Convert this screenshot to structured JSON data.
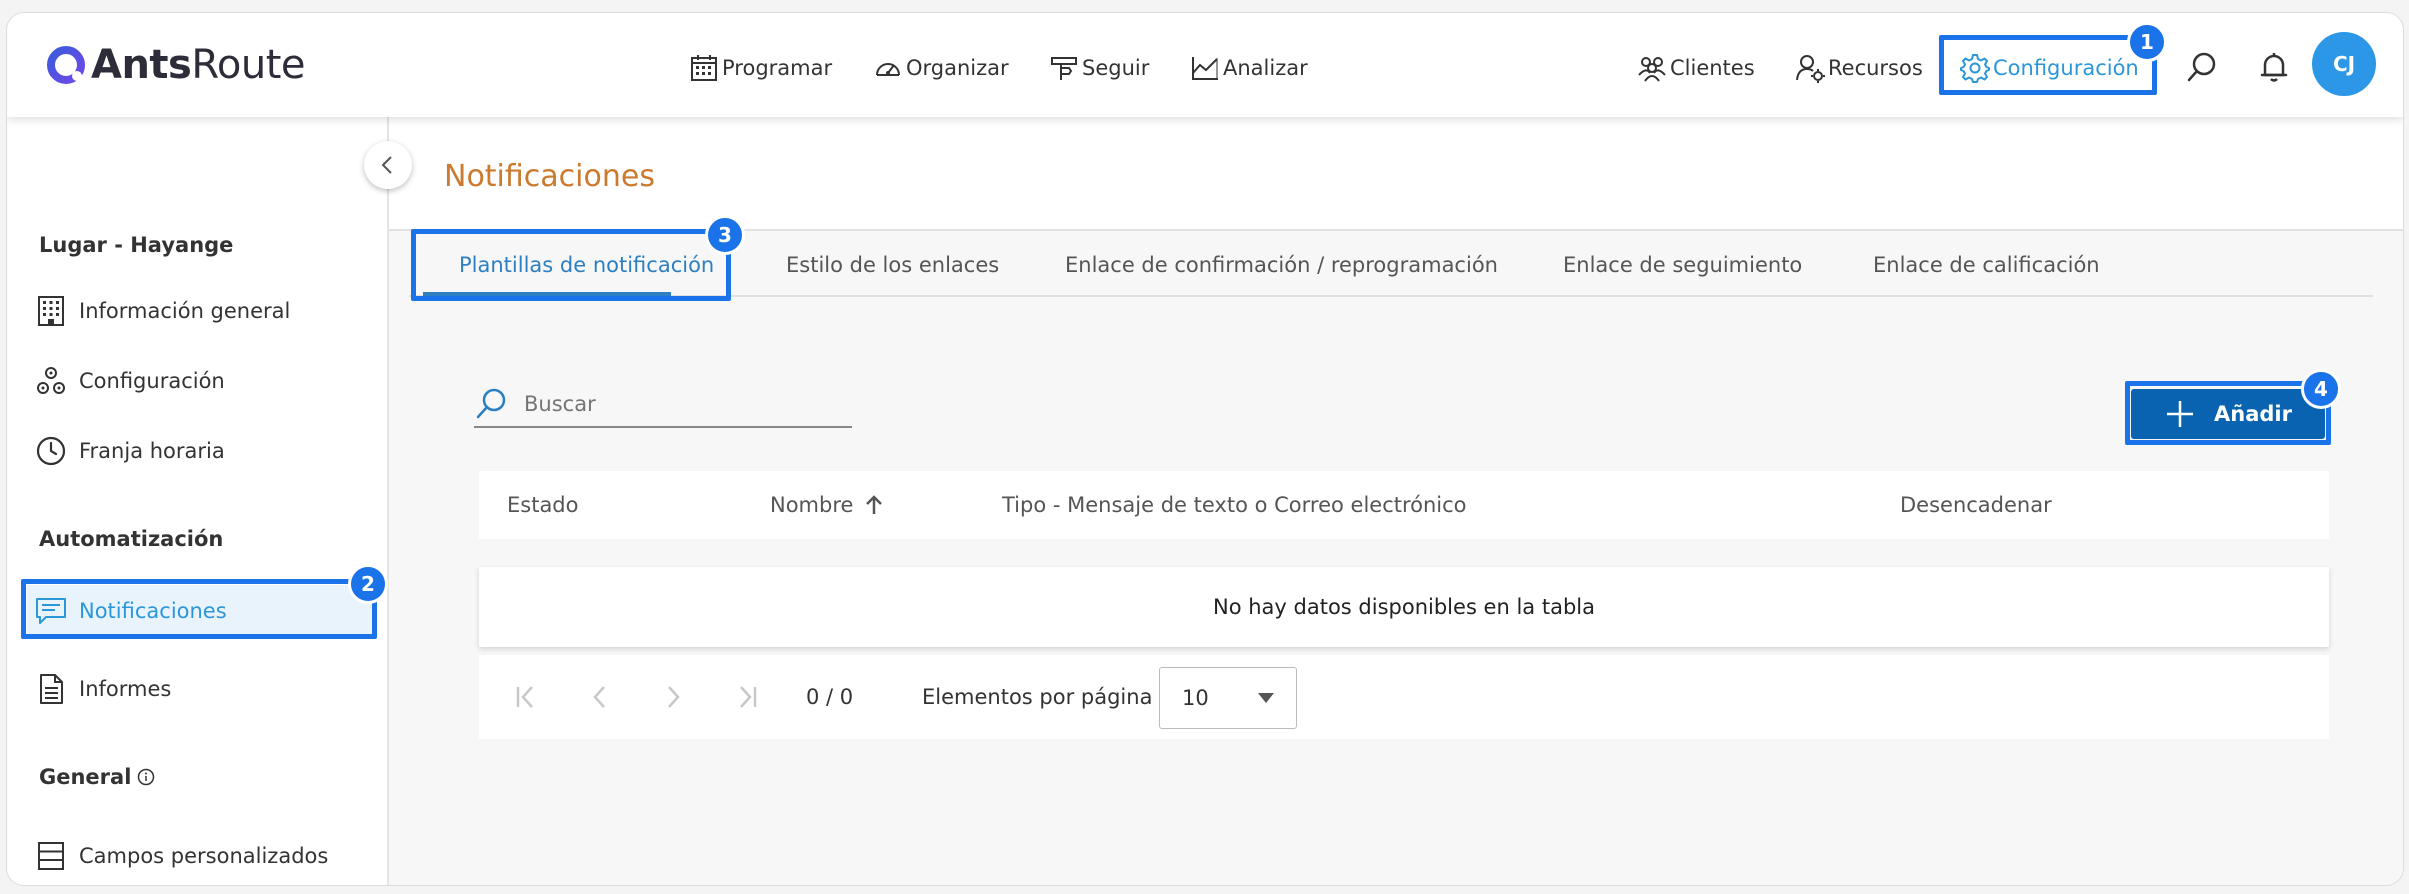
{
  "brand": {
    "part1": "Ants",
    "part2": "Route"
  },
  "nav": {
    "programar": "Programar",
    "organizar": "Organizar",
    "seguir": "Seguir",
    "analizar": "Analizar",
    "clientes": "Clientes",
    "recursos": "Recursos",
    "configuracion": "Configuración"
  },
  "user": {
    "initials": "CJ"
  },
  "badges": [
    "1",
    "2",
    "3",
    "4"
  ],
  "sidebar": {
    "section1": "Lugar - Hayange",
    "items1": [
      "Información general",
      "Configuración",
      "Franja horaria"
    ],
    "section2": "Automatización",
    "items2": [
      "Notificaciones",
      "Informes"
    ],
    "section3": "General",
    "items3": [
      "Campos personalizados"
    ]
  },
  "main": {
    "title": "Notificaciones",
    "tabs": [
      "Plantillas de notificación",
      "Estilo de los enlaces",
      "Enlace de confirmación / reprogramación",
      "Enlace de seguimiento",
      "Enlace de calificación"
    ],
    "search_placeholder": "Buscar",
    "add_label": "Añadir",
    "columns": [
      "Estado",
      "Nombre",
      "Tipo - Mensaje de texto o Correo electrónico",
      "Desencadenar"
    ],
    "empty_message": "No hay datos disponibles en la tabla",
    "pager": {
      "range": "0 / 0",
      "per_page_label": "Elementos por página",
      "per_page_value": "10"
    }
  },
  "colors": {
    "accent": "#2b97d9",
    "highlight": "#1a73e8",
    "primary_button": "#0a63b0",
    "title": "#cc7a30"
  }
}
